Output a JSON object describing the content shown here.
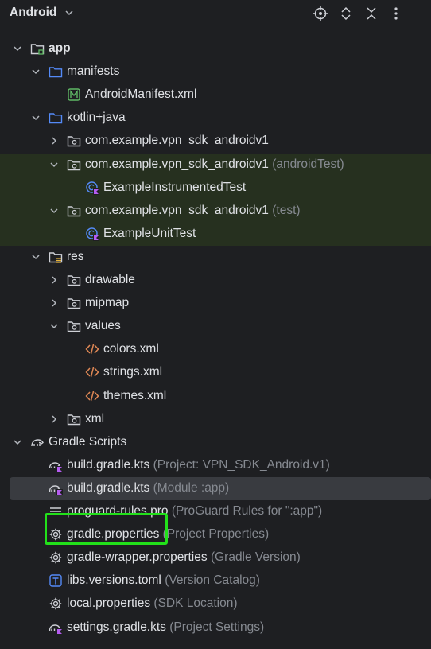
{
  "header": {
    "title": "Android",
    "icons": [
      "target-icon",
      "expand-collapse-icon",
      "collapse-all-icon",
      "more-vert-icon"
    ]
  },
  "tree": [
    {
      "label": "app",
      "suffix": "",
      "icon": "module-folder-icon",
      "expanded": true
    },
    {
      "label": "manifests",
      "suffix": "",
      "icon": "folder-icon",
      "expanded": true
    },
    {
      "label": "AndroidManifest.xml",
      "suffix": "",
      "icon": "manifest-file-icon"
    },
    {
      "label": "kotlin+java",
      "suffix": "",
      "icon": "folder-icon",
      "expanded": true
    },
    {
      "label": "com.example.vpn_sdk_androidv1",
      "suffix": "",
      "icon": "package-icon",
      "expanded": false
    },
    {
      "label": "com.example.vpn_sdk_androidv1",
      "suffix": "(androidTest)",
      "icon": "package-icon",
      "expanded": true
    },
    {
      "label": "ExampleInstrumentedTest",
      "suffix": "",
      "icon": "kotlin-test-class-icon"
    },
    {
      "label": "com.example.vpn_sdk_androidv1",
      "suffix": "(test)",
      "icon": "package-icon",
      "expanded": true
    },
    {
      "label": "ExampleUnitTest",
      "suffix": "",
      "icon": "kotlin-test-class-icon"
    },
    {
      "label": "res",
      "suffix": "",
      "icon": "res-folder-icon",
      "expanded": true
    },
    {
      "label": "drawable",
      "suffix": "",
      "icon": "package-icon",
      "expanded": false
    },
    {
      "label": "mipmap",
      "suffix": "",
      "icon": "package-icon",
      "expanded": false
    },
    {
      "label": "values",
      "suffix": "",
      "icon": "package-icon",
      "expanded": true
    },
    {
      "label": "colors.xml",
      "suffix": "",
      "icon": "xml-file-icon"
    },
    {
      "label": "strings.xml",
      "suffix": "",
      "icon": "xml-file-icon"
    },
    {
      "label": "themes.xml",
      "suffix": "",
      "icon": "xml-file-icon"
    },
    {
      "label": "xml",
      "suffix": "",
      "icon": "package-icon",
      "expanded": false
    },
    {
      "label": "Gradle Scripts",
      "suffix": "",
      "icon": "gradle-elephant-icon",
      "expanded": true
    },
    {
      "label": "build.gradle.kts",
      "suffix": "(Project: VPN_SDK_Android.v1)",
      "icon": "gradle-kts-icon"
    },
    {
      "label": "build.gradle.kts",
      "suffix": "(Module :app)",
      "icon": "gradle-kts-icon"
    },
    {
      "label": "proguard-rules.pro",
      "suffix": "(ProGuard Rules for \":app\")",
      "icon": "text-file-icon"
    },
    {
      "label": "gradle.properties",
      "suffix": "(Project Properties)",
      "icon": "properties-gear-icon"
    },
    {
      "label": "gradle-wrapper.properties",
      "suffix": "(Gradle Version)",
      "icon": "properties-gear-icon"
    },
    {
      "label": "libs.versions.toml",
      "suffix": "(Version Catalog)",
      "icon": "toml-file-icon"
    },
    {
      "label": "local.properties",
      "suffix": "(SDK Location)",
      "icon": "properties-gear-icon"
    },
    {
      "label": "settings.gradle.kts",
      "suffix": "(Project Settings)",
      "icon": "gradle-kts-icon"
    }
  ],
  "colors": {
    "background": "#1e1f22",
    "text": "#dfe1e5",
    "secondary_text": "#868a91",
    "test_highlight": "#26301f",
    "selection": "#393b40",
    "annotation_box": "#22e01a",
    "folder_blue": "#548af7",
    "xml_orange": "#e08855",
    "manifest_green": "#5fb865"
  }
}
